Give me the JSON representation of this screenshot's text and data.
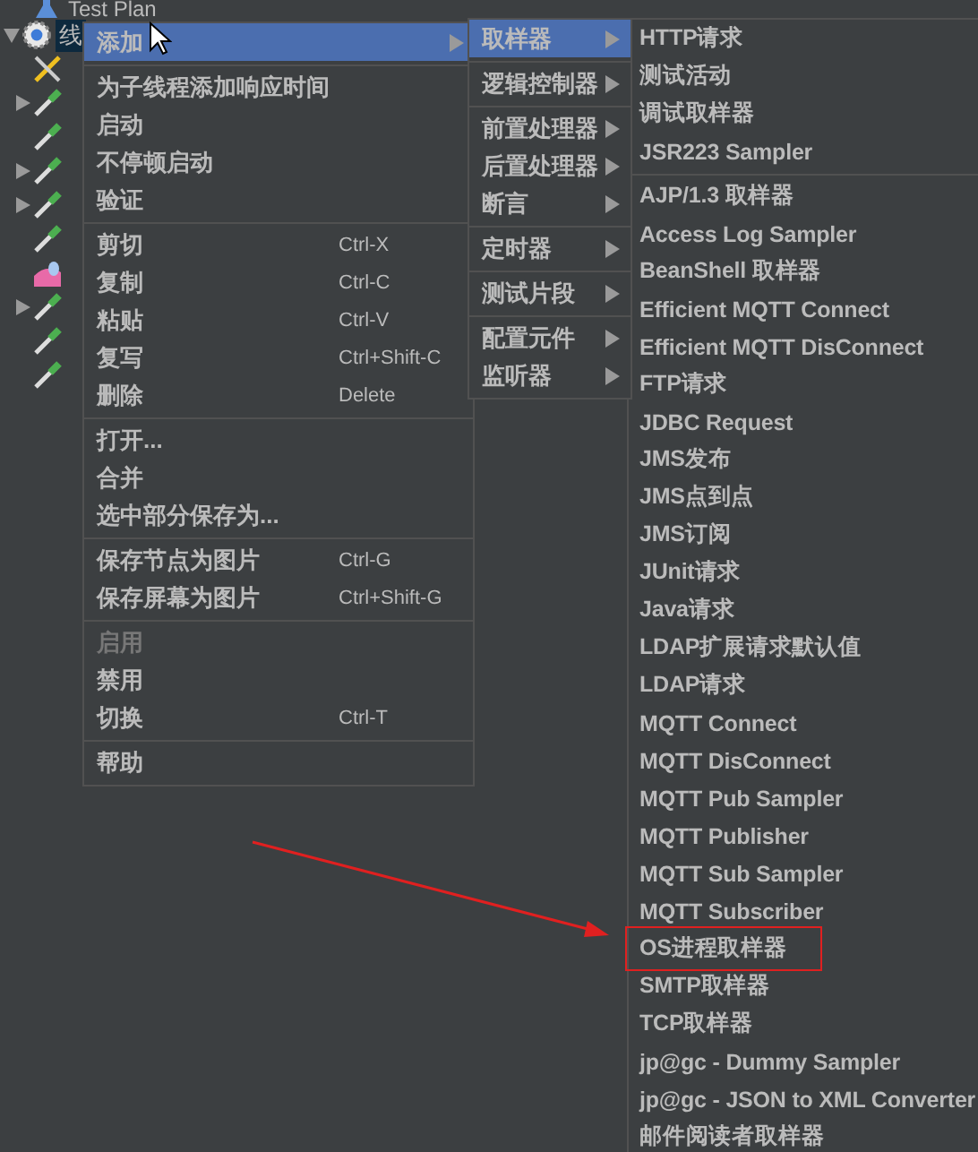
{
  "tree": {
    "root": "Test Plan",
    "selected_node": {
      "label": "线",
      "kind": "gear",
      "expanded": true,
      "selected": true
    },
    "children": [
      {
        "kind": "wrench"
      },
      {
        "kind": "pipette",
        "expanded": false
      },
      {
        "kind": "pipette"
      },
      {
        "kind": "pipette",
        "expanded": false
      },
      {
        "kind": "pipette",
        "expanded": false
      },
      {
        "kind": "pipette"
      },
      {
        "kind": "chart"
      },
      {
        "kind": "pipette",
        "expanded": false
      },
      {
        "kind": "pipette"
      },
      {
        "kind": "pipette"
      }
    ]
  },
  "context_menu": {
    "sections": [
      [
        {
          "label": "添加",
          "has_submenu": true,
          "selected": true,
          "disabled": false
        }
      ],
      [
        {
          "label": "为子线程添加响应时间",
          "has_submenu": false,
          "selected": false,
          "disabled": false
        },
        {
          "label": "启动",
          "has_submenu": false,
          "selected": false,
          "disabled": false
        },
        {
          "label": "不停顿启动",
          "has_submenu": false,
          "selected": false,
          "disabled": false
        },
        {
          "label": "验证",
          "has_submenu": false,
          "selected": false,
          "disabled": false
        }
      ],
      [
        {
          "label": "剪切",
          "shortcut": "Ctrl-X",
          "has_submenu": false,
          "selected": false,
          "disabled": false
        },
        {
          "label": "复制",
          "shortcut": "Ctrl-C",
          "has_submenu": false,
          "selected": false,
          "disabled": false
        },
        {
          "label": "粘贴",
          "shortcut": "Ctrl-V",
          "has_submenu": false,
          "selected": false,
          "disabled": false
        },
        {
          "label": "复写",
          "shortcut": "Ctrl+Shift-C",
          "has_submenu": false,
          "selected": false,
          "disabled": false
        },
        {
          "label": "删除",
          "shortcut": "Delete",
          "has_submenu": false,
          "selected": false,
          "disabled": false
        }
      ],
      [
        {
          "label": "打开...",
          "has_submenu": false,
          "selected": false,
          "disabled": false
        },
        {
          "label": "合并",
          "has_submenu": false,
          "selected": false,
          "disabled": false
        },
        {
          "label": "选中部分保存为...",
          "has_submenu": false,
          "selected": false,
          "disabled": false
        }
      ],
      [
        {
          "label": "保存节点为图片",
          "shortcut": "Ctrl-G",
          "has_submenu": false,
          "selected": false,
          "disabled": false
        },
        {
          "label": "保存屏幕为图片",
          "shortcut": "Ctrl+Shift-G",
          "has_submenu": false,
          "selected": false,
          "disabled": false
        }
      ],
      [
        {
          "label": "启用",
          "has_submenu": false,
          "selected": false,
          "disabled": true
        },
        {
          "label": "禁用",
          "has_submenu": false,
          "selected": false,
          "disabled": false
        },
        {
          "label": "切换",
          "shortcut": "Ctrl-T",
          "has_submenu": false,
          "selected": false,
          "disabled": false
        }
      ],
      [
        {
          "label": "帮助",
          "has_submenu": false,
          "selected": false,
          "disabled": false
        }
      ]
    ]
  },
  "add_submenu": {
    "sections": [
      [
        {
          "label": "取样器",
          "has_submenu": true,
          "selected": true,
          "disabled": false
        }
      ],
      [
        {
          "label": "逻辑控制器",
          "has_submenu": true,
          "selected": false,
          "disabled": false
        }
      ],
      [
        {
          "label": "前置处理器",
          "has_submenu": true,
          "selected": false,
          "disabled": false
        },
        {
          "label": "后置处理器",
          "has_submenu": true,
          "selected": false,
          "disabled": false
        },
        {
          "label": "断言",
          "has_submenu": true,
          "selected": false,
          "disabled": false
        }
      ],
      [
        {
          "label": "定时器",
          "has_submenu": true,
          "selected": false,
          "disabled": false
        }
      ],
      [
        {
          "label": "测试片段",
          "has_submenu": true,
          "selected": false,
          "disabled": false
        }
      ],
      [
        {
          "label": "配置元件",
          "has_submenu": true,
          "selected": false,
          "disabled": false
        },
        {
          "label": "监听器",
          "has_submenu": true,
          "selected": false,
          "disabled": false
        }
      ]
    ]
  },
  "sampler_submenu": {
    "sections": [
      [
        {
          "label": "HTTP请求",
          "highlighted": false
        },
        {
          "label": "测试活动",
          "highlighted": false
        },
        {
          "label": "调试取样器",
          "highlighted": false
        },
        {
          "label": "JSR223 Sampler",
          "highlighted": false
        }
      ],
      [
        {
          "label": "AJP/1.3 取样器",
          "highlighted": false
        },
        {
          "label": "Access Log Sampler",
          "highlighted": false
        },
        {
          "label": "BeanShell 取样器",
          "highlighted": false
        },
        {
          "label": "Efficient MQTT Connect",
          "highlighted": false
        },
        {
          "label": "Efficient MQTT DisConnect",
          "highlighted": false
        },
        {
          "label": "FTP请求",
          "highlighted": false
        },
        {
          "label": "JDBC Request",
          "highlighted": false
        },
        {
          "label": "JMS发布",
          "highlighted": false
        },
        {
          "label": "JMS点到点",
          "highlighted": false
        },
        {
          "label": "JMS订阅",
          "highlighted": false
        },
        {
          "label": "JUnit请求",
          "highlighted": false
        },
        {
          "label": "Java请求",
          "highlighted": false
        },
        {
          "label": "LDAP扩展请求默认值",
          "highlighted": false
        },
        {
          "label": "LDAP请求",
          "highlighted": false
        },
        {
          "label": "MQTT Connect",
          "highlighted": false
        },
        {
          "label": "MQTT DisConnect",
          "highlighted": false
        },
        {
          "label": "MQTT Pub Sampler",
          "highlighted": false
        },
        {
          "label": "MQTT Publisher",
          "highlighted": false
        },
        {
          "label": "MQTT Sub Sampler",
          "highlighted": false
        },
        {
          "label": "MQTT Subscriber",
          "highlighted": false
        },
        {
          "label": "OS进程取样器",
          "highlighted": true
        },
        {
          "label": "SMTP取样器",
          "highlighted": false
        },
        {
          "label": "TCP取样器",
          "highlighted": false
        },
        {
          "label": "jp@gc - Dummy Sampler",
          "highlighted": false
        },
        {
          "label": "jp@gc - JSON to XML Converter",
          "highlighted": false
        },
        {
          "label": "邮件阅读者取样器",
          "highlighted": false
        }
      ]
    ]
  }
}
